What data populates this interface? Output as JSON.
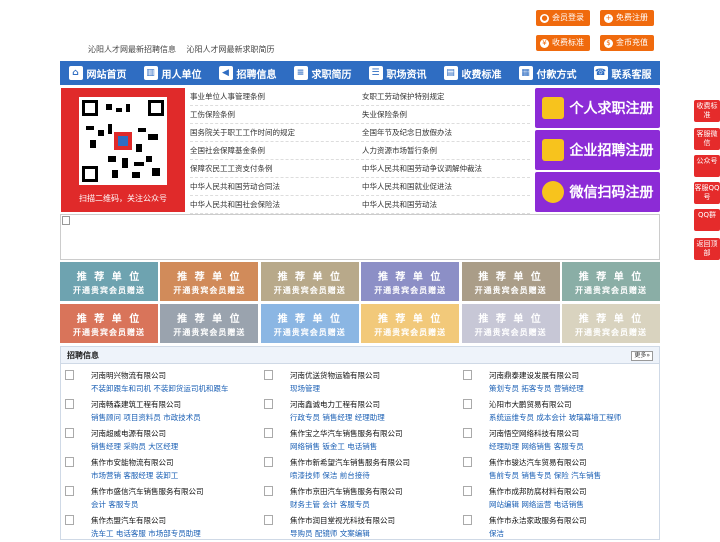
{
  "top_buttons": [
    {
      "label": "会员登录",
      "icon": "user-icon"
    },
    {
      "label": "免费注册",
      "icon": "user-add-icon"
    },
    {
      "label": "收费标准",
      "icon": "price-icon"
    },
    {
      "label": "金币充值",
      "icon": "coin-icon"
    }
  ],
  "top_links": [
    "沁阳人才网最新招聘信息",
    "沁阳人才网最新求职简历"
  ],
  "nav": [
    {
      "label": "网站首页",
      "icon": "home-icon"
    },
    {
      "label": "用人单位",
      "icon": "building-icon"
    },
    {
      "label": "招聘信息",
      "icon": "megaphone-icon"
    },
    {
      "label": "求职简历",
      "icon": "resume-icon"
    },
    {
      "label": "职场资讯",
      "icon": "news-icon"
    },
    {
      "label": "收费标准",
      "icon": "chart-icon"
    },
    {
      "label": "付款方式",
      "icon": "wallet-icon"
    },
    {
      "label": "联系客服",
      "icon": "phone-icon"
    }
  ],
  "qr_caption": "扫描二维码，关注公众号",
  "laws": [
    [
      "事业单位人事管理条例",
      "女职工劳动保护特别规定"
    ],
    [
      "工伤保险条例",
      "失业保险条例"
    ],
    [
      "国务院关于职工工作时间的规定",
      "全国年节及纪念日放假办法"
    ],
    [
      "全国社会保障基金条例",
      "人力资源市场暂行条例"
    ],
    [
      "保障农民工工资支付条例",
      "中华人民共和国劳动争议调解仲裁法"
    ],
    [
      "中华人民共和国劳动合同法",
      "中华人民共和国就业促进法"
    ],
    [
      "中华人民共和国社会保险法",
      "中华人民共和国劳动法"
    ]
  ],
  "register": [
    {
      "label": "个人求职注册",
      "icon": "person-icon"
    },
    {
      "label": "企业招聘注册",
      "icon": "company-icon"
    },
    {
      "label": "微信扫码注册",
      "icon": "wechat-icon"
    }
  ],
  "tile_title": "推 荐 单 位",
  "tile_subtitle": "开通贵宾会员赠送",
  "tile_colors": [
    "#6ea3b0",
    "#d18b5a",
    "#b8a98a",
    "#8c8fc6",
    "#aa9d88",
    "#8aaea6",
    "#d9745a",
    "#9aa3ae",
    "#8bb6e3",
    "#f2c97a",
    "#c7c7d6",
    "#d9d3bf"
  ],
  "jobs_title": "招聘信息",
  "jobs_more": "更多»",
  "jobs": [
    [
      {
        "company": "河南明兴物流有限公司",
        "positions": "不装卸跟车和司机 不装卸货运司机和跟车"
      },
      {
        "company": "河南畅森建筑工程有限公司",
        "positions": "销售顾问 项目资料员 市政技术员"
      },
      {
        "company": "河南超威电源有限公司",
        "positions": "销售经理 采购员 大区经理"
      },
      {
        "company": "焦作市安能物流有限公司",
        "positions": "市场营销 客服经理 装卸工"
      },
      {
        "company": "焦作市盛信汽车销售服务有限公司",
        "positions": "会计 客服专员"
      },
      {
        "company": "焦作杰盟汽车有限公司",
        "positions": "洗车工 电话客服 市场部专员助理"
      }
    ],
    [
      {
        "company": "河南优送货物运输有限公司",
        "positions": "现场管理"
      },
      {
        "company": "河南鑫诚电力工程有限公司",
        "positions": "行政专员 销售经理 经理助理"
      },
      {
        "company": "焦作宝之华汽车销售服务有限公司",
        "positions": "网络销售 钣金工 电话销售"
      },
      {
        "company": "焦作市新希望汽车销售服务有限公司",
        "positions": "喷漆技师 保洁 前台接待"
      },
      {
        "company": "焦作市京田汽车销售服务有限公司",
        "positions": "财务主管 会计 客服专员"
      },
      {
        "company": "焦作市润目堂视光科技有限公司",
        "positions": "导购员 配镜师 文案编辑"
      }
    ],
    [
      {
        "company": "河南鼎泰建设发展有限公司",
        "positions": "策划专员 拓客专员 营销经理"
      },
      {
        "company": "沁阳市大鹏贸易有限公司",
        "positions": "系统运维专员 成本会计 玻璃幕墙工程师"
      },
      {
        "company": "河南悟空网络科技有限公司",
        "positions": "经理助理 网络销售 客服专员"
      },
      {
        "company": "焦作市骏达汽车贸易有限公司",
        "positions": "售前专员 销售专员 保险 汽车销售"
      },
      {
        "company": "焦作市成邦防腐材料有限公司",
        "positions": "网站编辑 网络运营 电话销售"
      },
      {
        "company": "焦作市永洁家政服务有限公司",
        "positions": "保洁"
      }
    ]
  ],
  "side_buttons": [
    "收费标准",
    "客服微信",
    "公众号",
    "客服QQ号",
    "QQ群",
    "返回顶部"
  ]
}
